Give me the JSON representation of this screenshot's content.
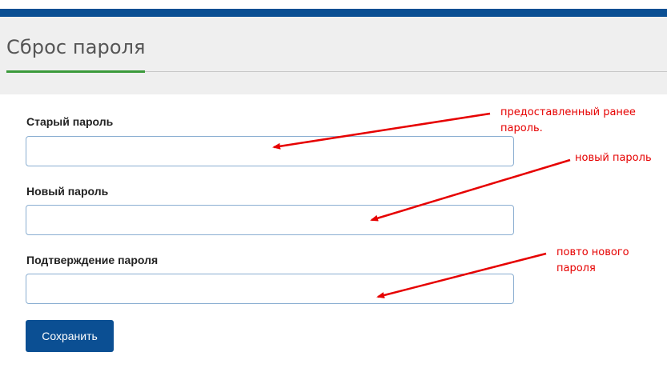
{
  "page": {
    "title": "Сброс пароля"
  },
  "form": {
    "old_password_label": "Старый пароль",
    "new_password_label": "Новый пароль",
    "confirm_password_label": "Подтверждение пароля",
    "old_password_value": "",
    "new_password_value": "",
    "confirm_password_value": "",
    "save_label": "Сохранить"
  },
  "annotations": {
    "old_note_line1": "предоставленный ранее",
    "old_note_line2": "пароль.",
    "new_note": "новый пароль",
    "confirm_note_line1": "повто нового",
    "confirm_note_line2": "пароля"
  },
  "colors": {
    "brand_blue": "#0b4f93",
    "tab_accent_green": "#3a9a3a",
    "annotation_red": "#e60000"
  }
}
